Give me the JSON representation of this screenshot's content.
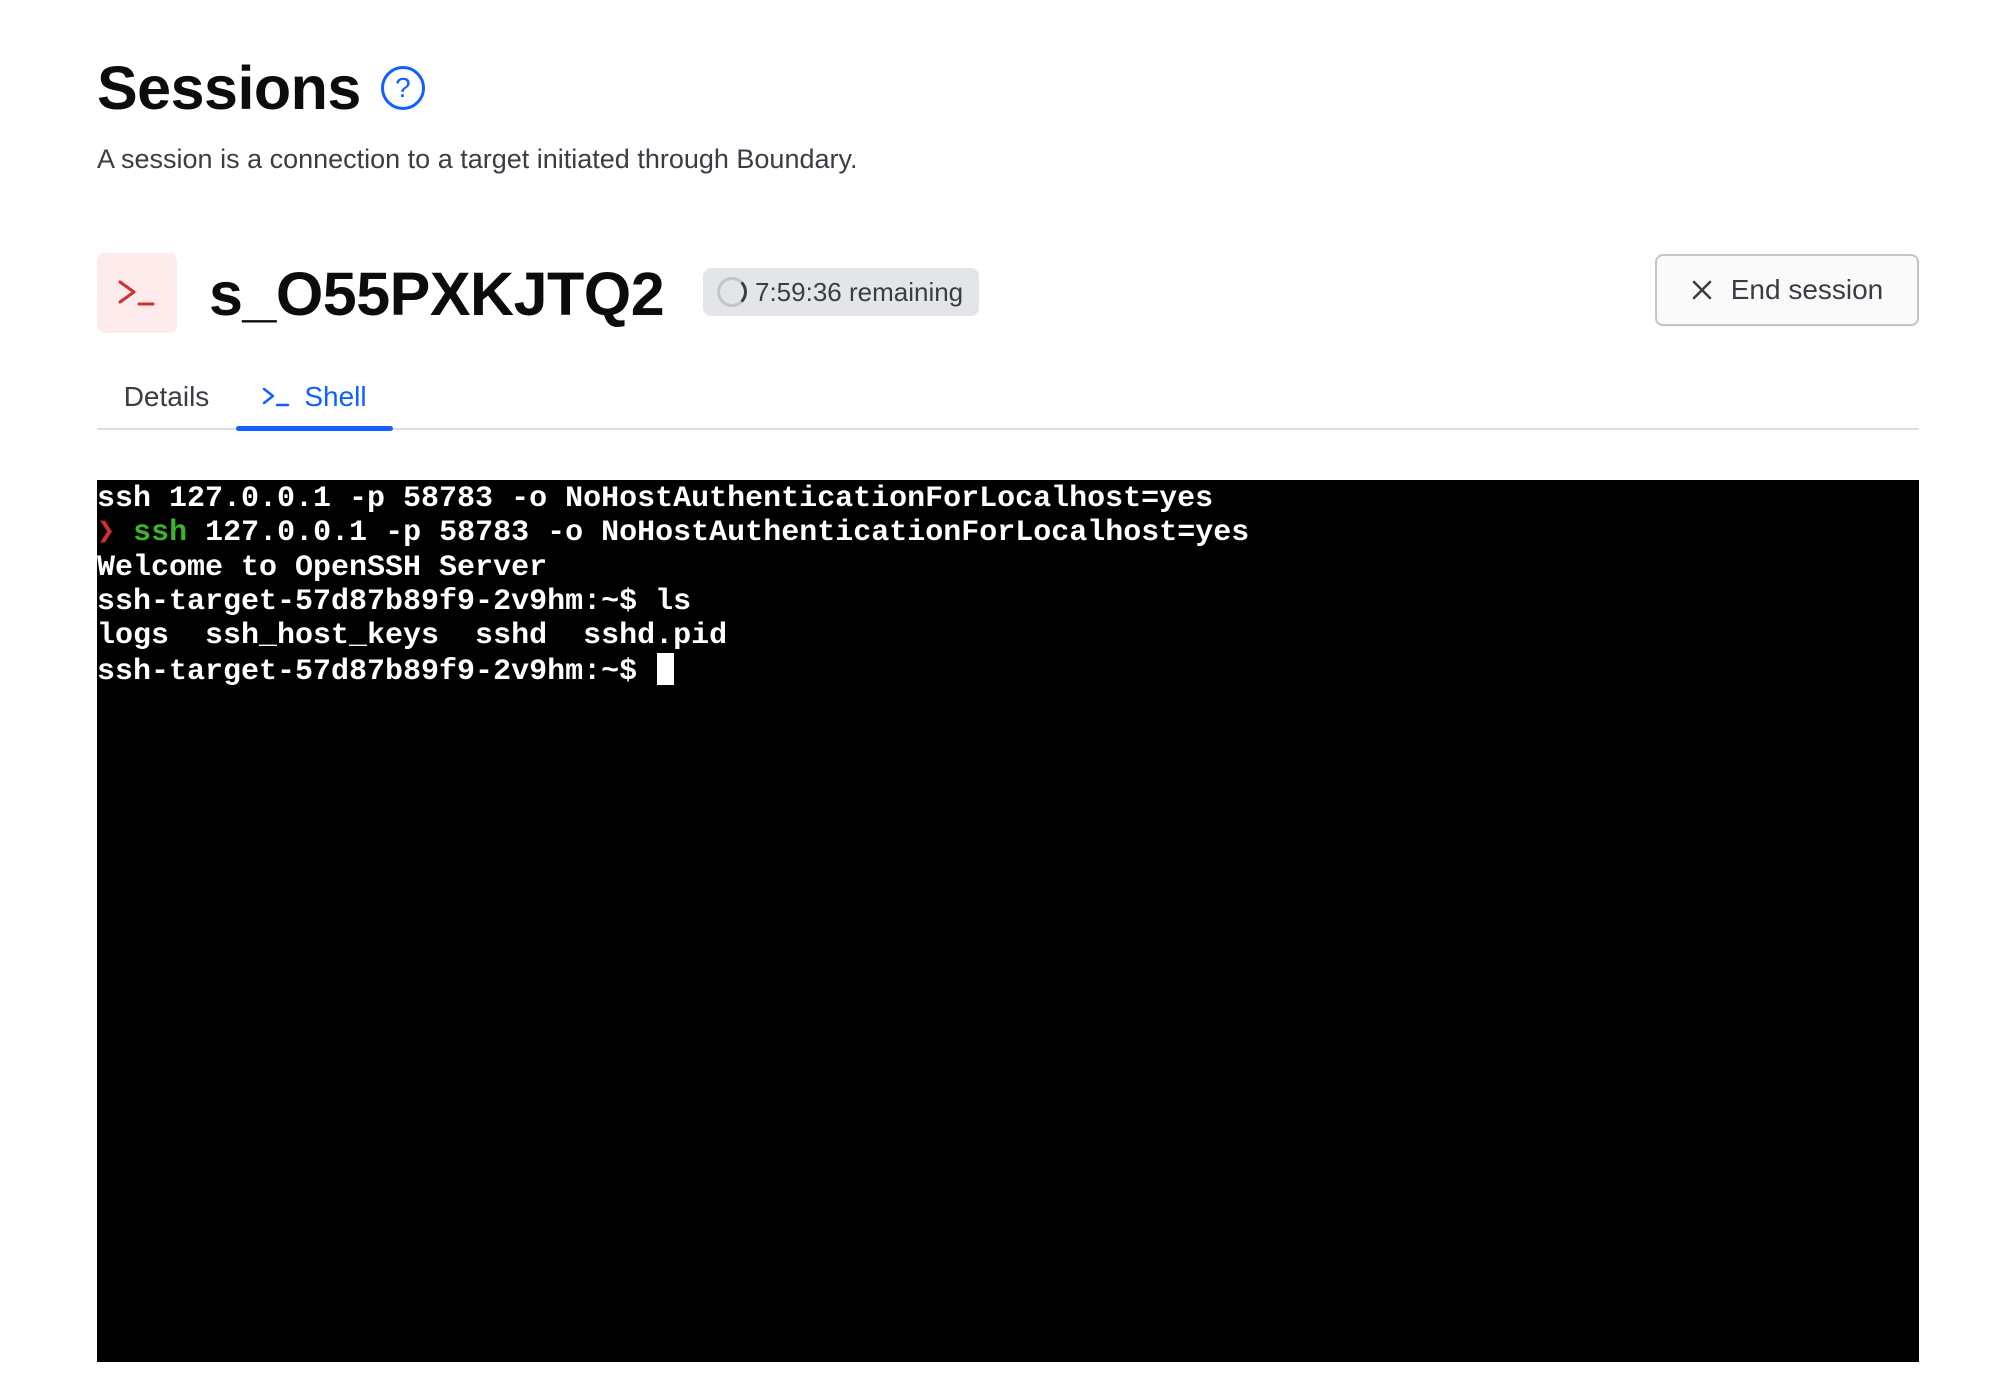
{
  "header": {
    "title": "Sessions",
    "help_icon": "question-circle-icon",
    "subtitle": "A session is a connection to a target initiated through Boundary."
  },
  "session": {
    "icon": "terminal-prompt-icon",
    "id": "s_O55PXKJTQ2",
    "remaining": "7:59:36 remaining",
    "end_button_label": "End session",
    "end_button_icon": "close-icon"
  },
  "tabs": [
    {
      "label": "Details",
      "active": false
    },
    {
      "label": "Shell",
      "active": true,
      "icon": "terminal-prompt-icon"
    }
  ],
  "terminal": {
    "lines": [
      {
        "text": "ssh 127.0.0.1 -p 58783 -o NoHostAuthenticationForLocalhost=yes"
      },
      {
        "prompt_symbol": "❯ ",
        "command": "ssh",
        "args": " 127.0.0.1 -p 58783 -o NoHostAuthenticationForLocalhost=yes"
      },
      {
        "text": "Welcome to OpenSSH Server"
      },
      {
        "text": "ssh-target-57d87b89f9-2v9hm:~$ ls"
      },
      {
        "text": "logs  ssh_host_keys  sshd  sshd.pid"
      },
      {
        "text": "ssh-target-57d87b89f9-2v9hm:~$ "
      }
    ]
  },
  "colors": {
    "accent": "#1060ff",
    "danger": "#d03030",
    "terminal_bg": "#000000",
    "terminal_green": "#3cb52a",
    "icon_tile_bg": "#fdeaea"
  }
}
